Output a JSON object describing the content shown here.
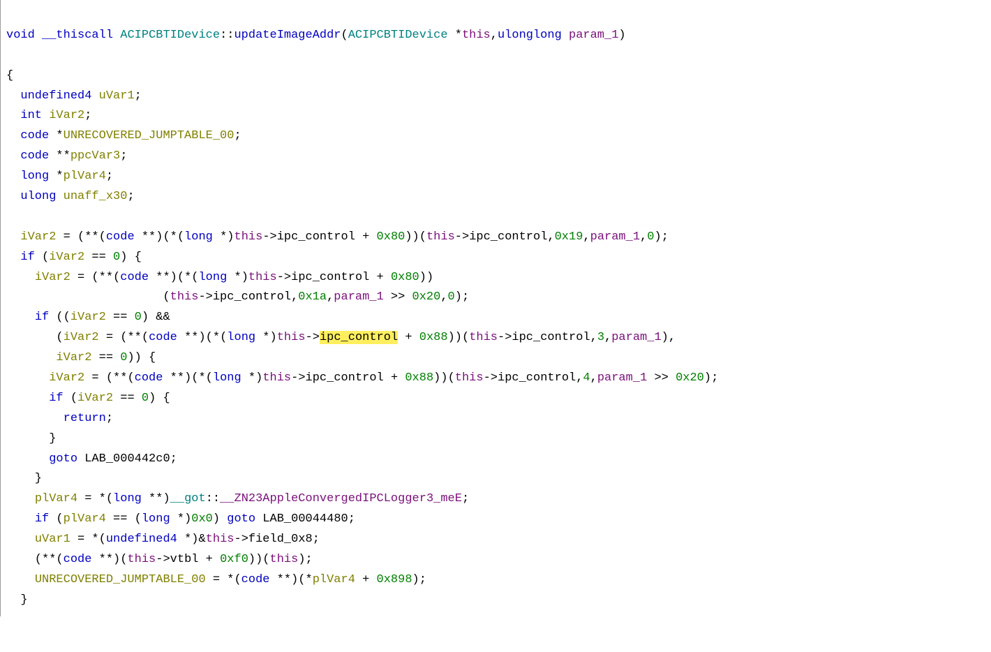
{
  "signature": {
    "ret_type": "void",
    "callconv": "__thiscall",
    "class": "ACIPCBTIDevice",
    "method": "updateImageAddr",
    "params": "(ACIPCBTIDevice *this,ulonglong param_1)",
    "param_type_1": "ACIPCBTIDevice",
    "param_ptr_1": "*",
    "param_name_1": "this",
    "param_type_2": "ulonglong",
    "param_name_2": "param_1"
  },
  "decls": {
    "d1_type": "undefined4",
    "d1_name": "uVar1",
    "d2_type": "int",
    "d2_name": "iVar2",
    "d3_type": "code",
    "d3_ptr": "*",
    "d3_name": "UNRECOVERED_JUMPTABLE_00",
    "d4_type": "code",
    "d4_ptr": "**",
    "d4_name": "ppcVar3",
    "d5_type": "long",
    "d5_ptr": "*",
    "d5_name": "plVar4",
    "d6_type": "ulong",
    "d6_name": "unaff_x30"
  },
  "tokens": {
    "this": "this",
    "param1": "param_1",
    "ipc_control": "ipc_control",
    "ipc_control_hl": "ipc_control",
    "vtbl": "vtbl",
    "field_0x8": "field_0x8",
    "iVar2": "iVar2",
    "uVar1": "uVar1",
    "plVar4": "plVar4",
    "jumptable": "UNRECOVERED_JUMPTABLE_00",
    "code": "code",
    "long": "long",
    "undefined4": "undefined4",
    "got": "__got",
    "logger_sym": "__ZN23AppleConvergedIPCLogger3_meE",
    "if": "if",
    "return": "return",
    "goto": "goto",
    "lab1": "LAB_000442c0",
    "lab2": "LAB_00044480"
  },
  "nums": {
    "h80": "0x80",
    "h19": "0x19",
    "h1a": "0x1a",
    "h20": "0x20",
    "h88": "0x88",
    "hf0": "0xf0",
    "h898": "0x898",
    "h0x0": "0x0",
    "n0": "0",
    "n3": "3",
    "n4": "4"
  },
  "braces": {
    "open": "{",
    "close": "}"
  }
}
